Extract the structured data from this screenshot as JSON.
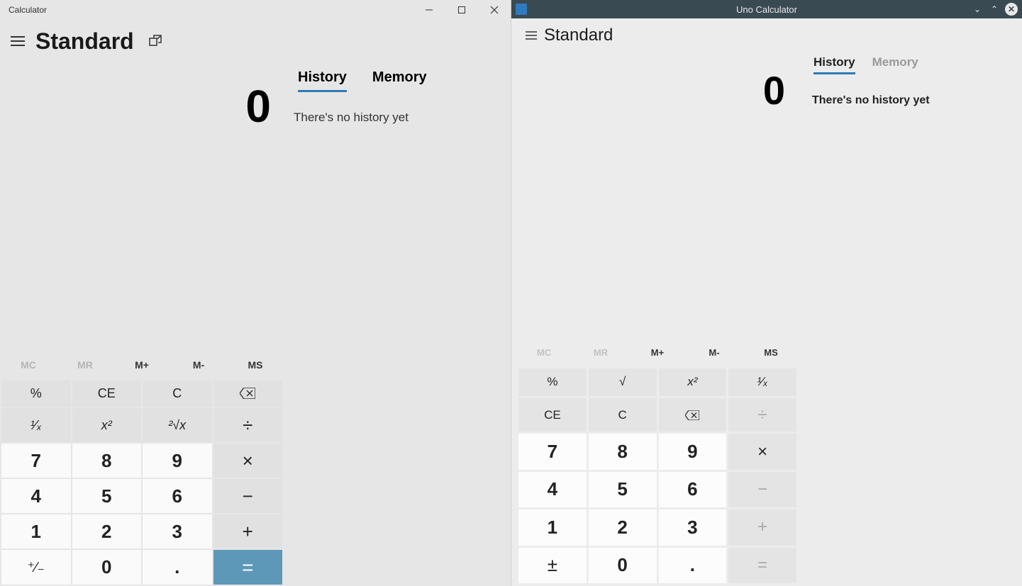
{
  "left": {
    "window_title": "Calculator",
    "mode": "Standard",
    "tabs": {
      "history": "History",
      "memory": "Memory"
    },
    "no_history": "There's no history yet",
    "display": "0",
    "memory": {
      "mc": "MC",
      "mr": "MR",
      "mplus": "M+",
      "mminus": "M-",
      "ms": "MS"
    },
    "keys": {
      "percent": "%",
      "ce": "CE",
      "c": "C",
      "recip": "¹⁄ₓ",
      "sq": "x²",
      "sqrt": "²√x",
      "div": "÷",
      "k7": "7",
      "k8": "8",
      "k9": "9",
      "mul": "×",
      "k4": "4",
      "k5": "5",
      "k6": "6",
      "sub": "−",
      "k1": "1",
      "k2": "2",
      "k3": "3",
      "add": "+",
      "neg": "⁺∕₋",
      "k0": "0",
      "dot": ".",
      "eq": "="
    }
  },
  "right": {
    "window_title": "Uno Calculator",
    "mode": "Standard",
    "tabs": {
      "history": "History",
      "memory": "Memory"
    },
    "no_history": "There's no history yet",
    "display": "0",
    "memory": {
      "mc": "MC",
      "mr": "MR",
      "mplus": "M+",
      "mminus": "M-",
      "ms": "MS"
    },
    "keys": {
      "percent": "%",
      "sqrt": "√",
      "sq": "x²",
      "recip": "¹⁄ₓ",
      "ce": "CE",
      "c": "C",
      "div": "÷",
      "k7": "7",
      "k8": "8",
      "k9": "9",
      "mul": "×",
      "k4": "4",
      "k5": "5",
      "k6": "6",
      "sub": "−",
      "k1": "1",
      "k2": "2",
      "k3": "3",
      "add": "+",
      "neg": "±",
      "k0": "0",
      "dot": ".",
      "eq": "="
    }
  }
}
